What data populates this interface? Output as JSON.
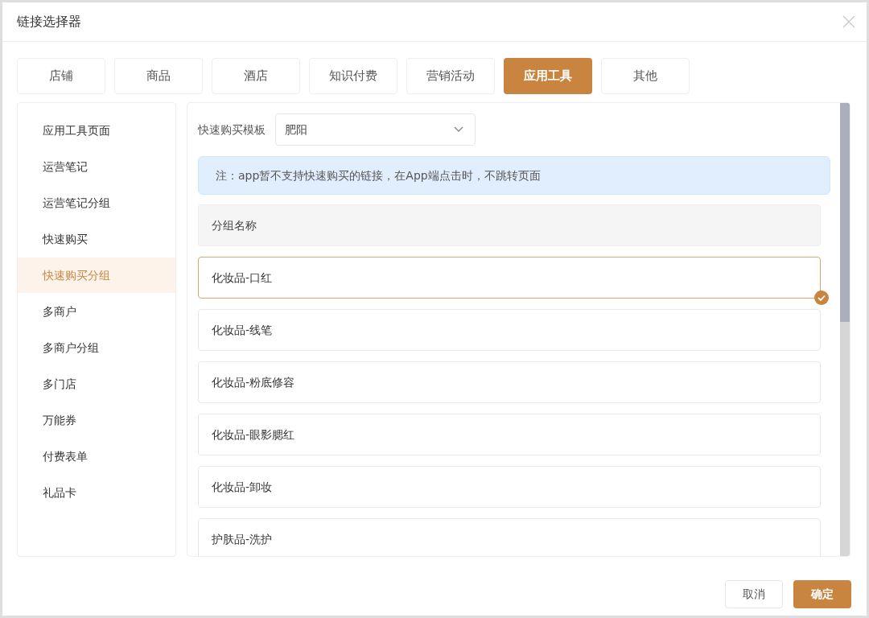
{
  "window": {
    "title": "链接选择器"
  },
  "tabs": [
    {
      "label": "店铺",
      "selected": false
    },
    {
      "label": "商品",
      "selected": false
    },
    {
      "label": "酒店",
      "selected": false
    },
    {
      "label": "知识付费",
      "selected": false
    },
    {
      "label": "营销活动",
      "selected": false
    },
    {
      "label": "应用工具",
      "selected": true
    },
    {
      "label": "其他",
      "selected": false
    }
  ],
  "sidebar": {
    "items": [
      {
        "label": "应用工具页面",
        "selected": false
      },
      {
        "label": "运营笔记",
        "selected": false
      },
      {
        "label": "运营笔记分组",
        "selected": false
      },
      {
        "label": "快速购买",
        "selected": false
      },
      {
        "label": "快速购买分组",
        "selected": true
      },
      {
        "label": "多商户",
        "selected": false
      },
      {
        "label": "多商户分组",
        "selected": false
      },
      {
        "label": "多门店",
        "selected": false
      },
      {
        "label": "万能券",
        "selected": false
      },
      {
        "label": "付费表单",
        "selected": false
      },
      {
        "label": "礼品卡",
        "selected": false
      }
    ]
  },
  "template_select": {
    "label": "快速购买模板",
    "value": "肥阳"
  },
  "notice": "注：app暂不支持快速购买的链接，在App端点击时，不跳转页面",
  "list": {
    "header": "分组名称",
    "rows": [
      {
        "label": "化妆品-口红",
        "selected": true
      },
      {
        "label": "化妆品-线笔",
        "selected": false
      },
      {
        "label": "化妆品-粉底修容",
        "selected": false
      },
      {
        "label": "化妆品-眼影腮红",
        "selected": false
      },
      {
        "label": "化妆品-卸妆",
        "selected": false
      },
      {
        "label": "护肤品-洗护",
        "selected": false
      }
    ]
  },
  "buttons": {
    "cancel": "取消",
    "confirm": "确定"
  }
}
